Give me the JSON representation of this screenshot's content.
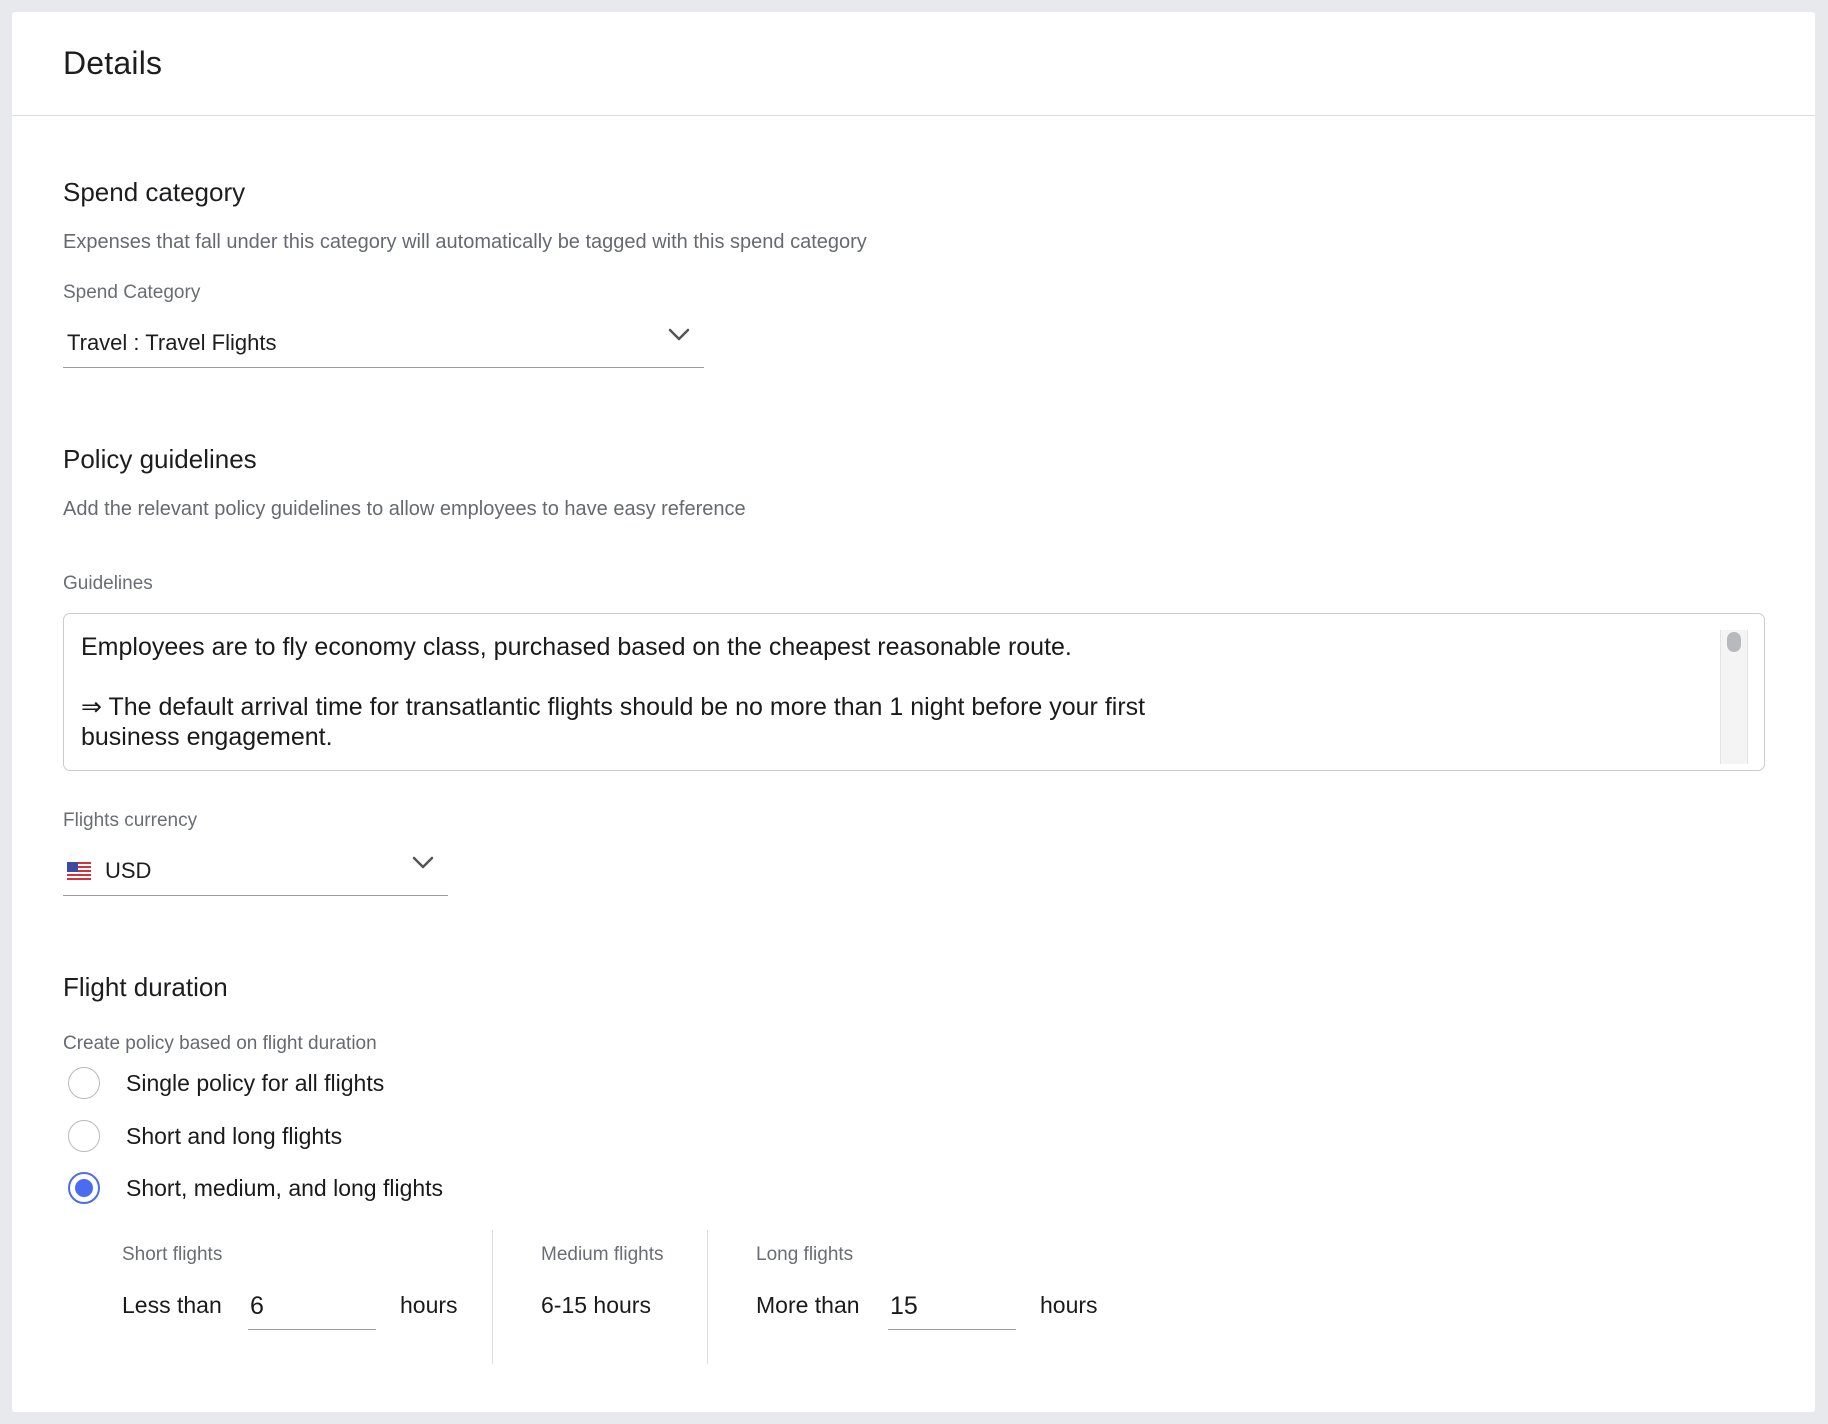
{
  "header": {
    "title": "Details"
  },
  "spend_category": {
    "title": "Spend category",
    "description": "Expenses that fall under this category will automatically be tagged with this spend category",
    "field_label": "Spend Category",
    "selected_value": "Travel : Travel Flights"
  },
  "policy": {
    "title": "Policy guidelines",
    "description": "Add the relevant policy guidelines to allow employees to have easy reference",
    "guidelines_label": "Guidelines",
    "guidelines_text": "Employees are to fly economy class, purchased based on the cheapest reasonable route.\n\n⇒ The default arrival time for transatlantic flights should be no more than 1 night before your first\nbusiness engagement."
  },
  "currency": {
    "field_label": "Flights currency",
    "selected_value": "USD",
    "flag_icon": "us-flag-icon"
  },
  "flight_duration": {
    "title": "Flight duration",
    "description": "Create policy based on flight duration",
    "options": [
      {
        "label": "Single policy for all flights",
        "checked": false
      },
      {
        "label": "Short and long flights",
        "checked": false
      },
      {
        "label": "Short, medium, and long flights",
        "checked": true
      }
    ],
    "short": {
      "label": "Short flights",
      "prefix": "Less than",
      "value": "6",
      "suffix": "hours"
    },
    "medium": {
      "label": "Medium flights",
      "text": "6-15 hours"
    },
    "long": {
      "label": "Long flights",
      "prefix": "More than",
      "value": "15",
      "suffix": "hours"
    }
  },
  "colors": {
    "accent": "#4b6cf0",
    "background": "#e8e9ec",
    "card": "#ffffff"
  }
}
